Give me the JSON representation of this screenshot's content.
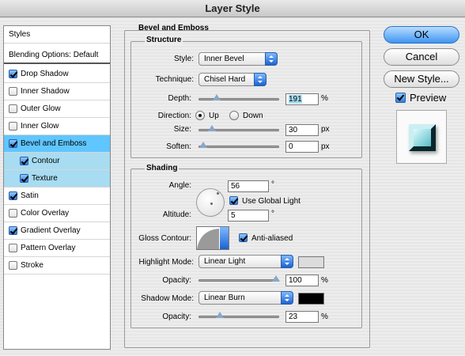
{
  "window": {
    "title": "Layer Style"
  },
  "styles_list": {
    "header": "Styles",
    "blending": "Blending Options: Default",
    "items": [
      {
        "label": "Drop Shadow",
        "checked": true
      },
      {
        "label": "Inner Shadow",
        "checked": false
      },
      {
        "label": "Outer Glow",
        "checked": false
      },
      {
        "label": "Inner Glow",
        "checked": false
      },
      {
        "label": "Bevel and Emboss",
        "checked": true,
        "selected": true
      },
      {
        "label": "Contour",
        "checked": true,
        "sub": true
      },
      {
        "label": "Texture",
        "checked": true,
        "sub": true
      },
      {
        "label": "Satin",
        "checked": true
      },
      {
        "label": "Color Overlay",
        "checked": false
      },
      {
        "label": "Gradient Overlay",
        "checked": true
      },
      {
        "label": "Pattern Overlay",
        "checked": false
      },
      {
        "label": "Stroke",
        "checked": false
      }
    ]
  },
  "bevel": {
    "group_title": "Bevel and Emboss",
    "structure": {
      "title": "Structure",
      "style_label": "Style:",
      "style_value": "Inner Bevel",
      "technique_label": "Technique:",
      "technique_value": "Chisel Hard",
      "depth_label": "Depth:",
      "depth_value": "191",
      "depth_unit": "%",
      "depth_level": 0.19,
      "direction_label": "Direction:",
      "direction_up": "Up",
      "direction_down": "Down",
      "direction_selected": "Up",
      "size_label": "Size:",
      "size_value": "30",
      "size_unit": "px",
      "size_level": 0.12,
      "soften_label": "Soften:",
      "soften_value": "0",
      "soften_unit": "px",
      "soften_level": 0.0
    },
    "shading": {
      "title": "Shading",
      "angle_label": "Angle:",
      "angle_value": "56",
      "angle_unit": "°",
      "use_global_label": "Use Global Light",
      "use_global_checked": true,
      "altitude_label": "Altitude:",
      "altitude_value": "5",
      "altitude_unit": "°",
      "gloss_label": "Gloss Contour:",
      "anti_aliased_label": "Anti-aliased",
      "anti_aliased_checked": true,
      "highlight_label": "Highlight Mode:",
      "highlight_value": "Linear Light",
      "highlight_color": "#dcdcdc",
      "highlight_opacity_label": "Opacity:",
      "highlight_opacity_value": "100",
      "highlight_opacity_unit": "%",
      "highlight_opacity_level": 1.0,
      "shadow_label": "Shadow Mode:",
      "shadow_value": "Linear Burn",
      "shadow_color": "#000000",
      "shadow_opacity_label": "Opacity:",
      "shadow_opacity_value": "23",
      "shadow_opacity_unit": "%",
      "shadow_opacity_level": 0.23
    }
  },
  "buttons": {
    "ok": "OK",
    "cancel": "Cancel",
    "new_style": "New Style..."
  },
  "preview": {
    "label": "Preview",
    "checked": true
  }
}
